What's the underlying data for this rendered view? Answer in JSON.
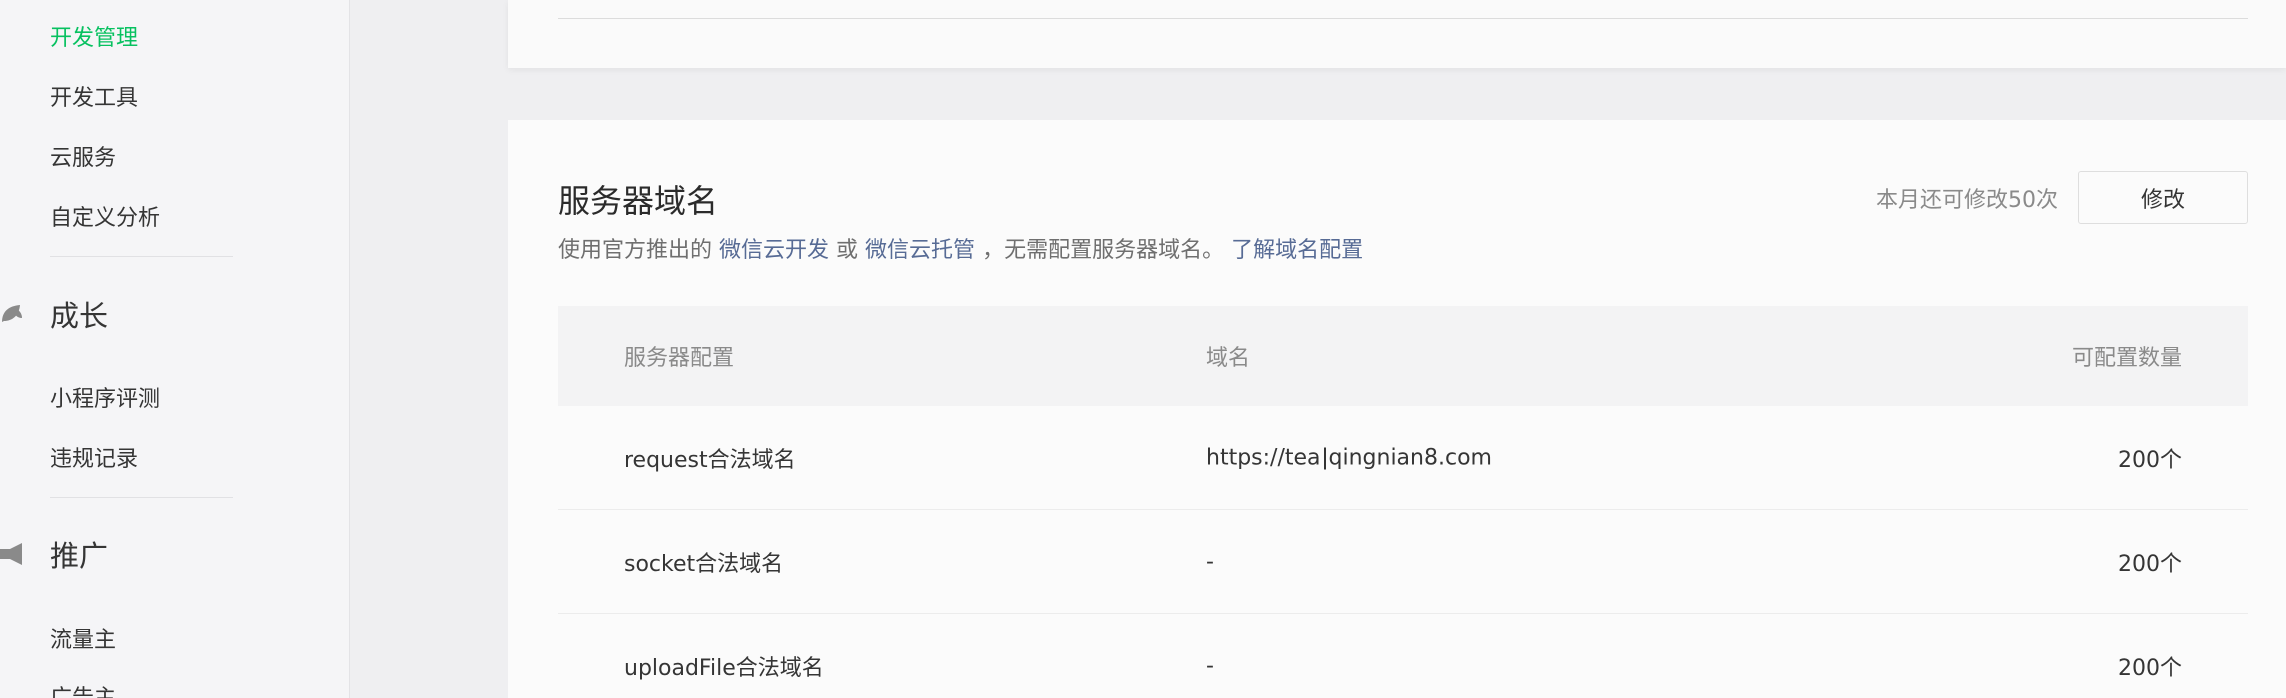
{
  "sidebar": {
    "items_top": [
      {
        "label": "开发管理",
        "active": true
      },
      {
        "label": "开发工具"
      },
      {
        "label": "云服务"
      },
      {
        "label": "自定义分析"
      }
    ],
    "section_growth": {
      "label": "成长",
      "icon": "leaf-icon",
      "items": [
        {
          "label": "小程序评测"
        },
        {
          "label": "违规记录"
        }
      ]
    },
    "section_promotion": {
      "label": "推广",
      "icon": "megaphone-icon",
      "items": [
        {
          "label": "流量主"
        },
        {
          "label": "广告主"
        }
      ]
    }
  },
  "server_domain": {
    "title": "服务器域名",
    "desc_prefix": "使用官方推出的",
    "link_cloud_dev": "微信云开发",
    "desc_or": "或",
    "link_cloud_host": "微信云托管",
    "desc_suffix": "，无需配置服务器域名。",
    "link_learn": "了解域名配置",
    "quota_text": "本月还可修改50次",
    "edit_label": "修改",
    "table": {
      "headers": [
        "服务器配置",
        "域名",
        "可配置数量"
      ],
      "rows": [
        {
          "name": "request合法域名",
          "domain_a": "https://tea",
          "domain_b": "qingnian8.com",
          "count": "200个"
        },
        {
          "name": "socket合法域名",
          "domain": "-",
          "count": "200个"
        },
        {
          "name": "uploadFile合法域名",
          "domain": "-",
          "count": "200个"
        }
      ]
    }
  },
  "colors": {
    "accent_green": "#07c160",
    "link_blue": "#576b95"
  }
}
